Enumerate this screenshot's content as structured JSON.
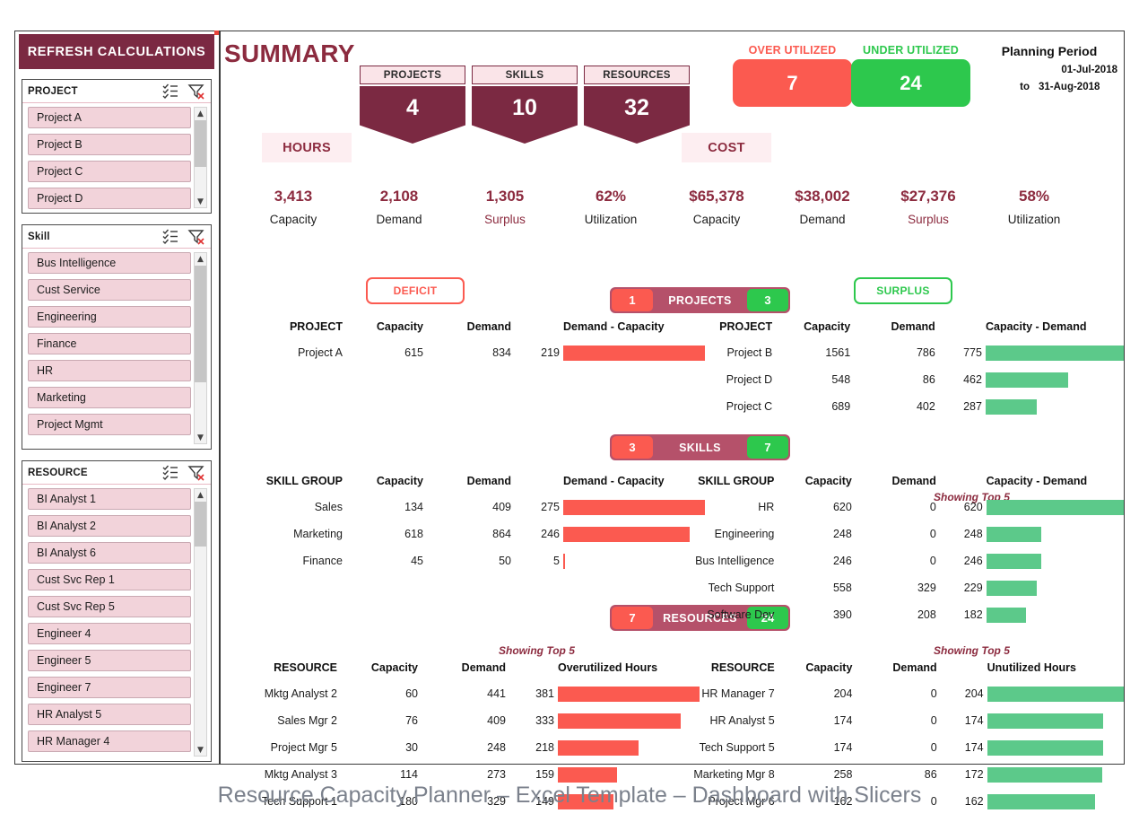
{
  "refresh_button": "REFRESH CALCULATIONS",
  "caption": "Resource Capacity Planner – Excel Template – Dashboard with Slicers",
  "colors": {
    "maroon": "#7b2942",
    "title_maroon": "#8c2b3f",
    "badge_band": "#b5516a",
    "red": "#fb5a50",
    "green": "#2dc84d",
    "bar_green": "#5cc98a",
    "slicer_item": "#f2d3da",
    "group_tag_bg": "#fdeef1",
    "caption_gray": "#7b818c"
  },
  "slicers": [
    {
      "id": "project",
      "title": "PROJECT",
      "multiselect_icon": "multi-select-icon",
      "clear_filter_icon": "clear-filter-icon",
      "items": [
        "Project A",
        "Project B",
        "Project C",
        "Project D"
      ]
    },
    {
      "id": "skill",
      "title": "Skill",
      "multiselect_icon": "multi-select-icon",
      "clear_filter_icon": "clear-filter-icon",
      "items": [
        "Bus Intelligence",
        "Cust Service",
        "Engineering",
        "Finance",
        "HR",
        "Marketing",
        "Project Mgmt"
      ]
    },
    {
      "id": "resource",
      "title": "RESOURCE",
      "multiselect_icon": "multi-select-icon",
      "clear_filter_icon": "clear-filter-icon",
      "items": [
        "BI Analyst 1",
        "BI Analyst 2",
        "BI Analyst 6",
        "Cust Svc Rep 1",
        "Cust Svc Rep 5",
        "Engineer 4",
        "Engineer 5",
        "Engineer 7",
        "HR Analyst 5",
        "HR Manager 4"
      ]
    }
  ],
  "header": {
    "title": "SUMMARY",
    "ribbons": [
      {
        "label": "PROJECTS",
        "value": "4"
      },
      {
        "label": "SKILLS",
        "value": "10"
      },
      {
        "label": "RESOURCES",
        "value": "32"
      }
    ],
    "utilization": [
      {
        "label": "OVER UTILIZED",
        "value": "7",
        "color": "#fb5a50",
        "label_color": "#fb5a50"
      },
      {
        "label": "UNDER UTILIZED",
        "value": "24",
        "color": "#2dc84d",
        "label_color": "#2dc84d"
      }
    ],
    "planning_period": {
      "title": "Planning Period",
      "from": "01-Jul-2018",
      "to_label": "to",
      "to": "31-Aug-2018"
    }
  },
  "groups": [
    {
      "tag": "HOURS",
      "metrics": [
        {
          "value": "3,413",
          "name": "Capacity",
          "accent": false
        },
        {
          "value": "2,108",
          "name": "Demand",
          "accent": false
        },
        {
          "value": "1,305",
          "name": "Surplus",
          "accent": true
        },
        {
          "value": "62%",
          "name": "Utilization",
          "accent": false
        }
      ]
    },
    {
      "tag": "COST",
      "metrics": [
        {
          "value": "$65,378",
          "name": "Capacity",
          "accent": false
        },
        {
          "value": "$38,002",
          "name": "Demand",
          "accent": false
        },
        {
          "value": "$27,376",
          "name": "Surplus",
          "accent": true
        },
        {
          "value": "58%",
          "name": "Utilization",
          "accent": false
        }
      ]
    }
  ],
  "badges": {
    "deficit": "DEFICIT",
    "surplus": "SURPLUS",
    "projects": {
      "name": "PROJECTS",
      "deficit_count": "1",
      "surplus_count": "3"
    },
    "skills": {
      "name": "SKILLS",
      "deficit_count": "3",
      "surplus_count": "7"
    },
    "resources": {
      "name": "RESOURCES",
      "deficit_count": "7",
      "surplus_count": "24"
    }
  },
  "showing_top": "Showing Top 5",
  "tables": {
    "projects_deficit": {
      "headers": [
        "PROJECT",
        "Capacity",
        "Demand",
        "Demand - Capacity"
      ],
      "rows": [
        {
          "name": "Project A",
          "capacity": "615",
          "demand": "834",
          "diff": "219",
          "bar_pct": 100
        }
      ]
    },
    "projects_surplus": {
      "headers": [
        "PROJECT",
        "Capacity",
        "Demand",
        "Capacity - Demand"
      ],
      "rows": [
        {
          "name": "Project B",
          "capacity": "1561",
          "demand": "786",
          "diff": "775",
          "bar_pct": 100
        },
        {
          "name": "Project D",
          "capacity": "548",
          "demand": "86",
          "diff": "462",
          "bar_pct": 60
        },
        {
          "name": "Project C",
          "capacity": "689",
          "demand": "402",
          "diff": "287",
          "bar_pct": 37
        }
      ]
    },
    "skills_deficit": {
      "headers": [
        "SKILL GROUP",
        "Capacity",
        "Demand",
        "Demand - Capacity"
      ],
      "rows": [
        {
          "name": "Sales",
          "capacity": "134",
          "demand": "409",
          "diff": "275",
          "bar_pct": 100
        },
        {
          "name": "Marketing",
          "capacity": "618",
          "demand": "864",
          "diff": "246",
          "bar_pct": 89
        },
        {
          "name": "Finance",
          "capacity": "45",
          "demand": "50",
          "diff": "5",
          "bar_pct": 1
        }
      ]
    },
    "skills_surplus": {
      "headers": [
        "SKILL GROUP",
        "Capacity",
        "Demand",
        "Capacity - Demand"
      ],
      "rows": [
        {
          "name": "HR",
          "capacity": "620",
          "demand": "0",
          "diff": "620",
          "bar_pct": 100
        },
        {
          "name": "Engineering",
          "capacity": "248",
          "demand": "0",
          "diff": "248",
          "bar_pct": 40
        },
        {
          "name": "Bus Intelligence",
          "capacity": "246",
          "demand": "0",
          "diff": "246",
          "bar_pct": 40
        },
        {
          "name": "Tech Support",
          "capacity": "558",
          "demand": "329",
          "diff": "229",
          "bar_pct": 37
        },
        {
          "name": "Software Dev",
          "capacity": "390",
          "demand": "208",
          "diff": "182",
          "bar_pct": 29
        }
      ]
    },
    "resources_over": {
      "headers": [
        "RESOURCE",
        "Capacity",
        "Demand",
        "Overutilized Hours"
      ],
      "rows": [
        {
          "name": "Mktg Analyst 2",
          "capacity": "60",
          "demand": "441",
          "diff": "381",
          "bar_pct": 100
        },
        {
          "name": "Sales Mgr 2",
          "capacity": "76",
          "demand": "409",
          "diff": "333",
          "bar_pct": 87
        },
        {
          "name": "Project Mgr 5",
          "capacity": "30",
          "demand": "248",
          "diff": "218",
          "bar_pct": 57
        },
        {
          "name": "Mktg Analyst 3",
          "capacity": "114",
          "demand": "273",
          "diff": "159",
          "bar_pct": 42
        },
        {
          "name": "Tech Support 1",
          "capacity": "180",
          "demand": "329",
          "diff": "149",
          "bar_pct": 39
        }
      ]
    },
    "resources_under": {
      "headers": [
        "RESOURCE",
        "Capacity",
        "Demand",
        "Unutilized Hours"
      ],
      "rows": [
        {
          "name": "HR Manager 7",
          "capacity": "204",
          "demand": "0",
          "diff": "204",
          "bar_pct": 100
        },
        {
          "name": "HR Analyst 5",
          "capacity": "174",
          "demand": "0",
          "diff": "174",
          "bar_pct": 85
        },
        {
          "name": "Tech Support 5",
          "capacity": "174",
          "demand": "0",
          "diff": "174",
          "bar_pct": 85
        },
        {
          "name": "Marketing Mgr 8",
          "capacity": "258",
          "demand": "86",
          "diff": "172",
          "bar_pct": 84
        },
        {
          "name": "Project Mgr 6",
          "capacity": "162",
          "demand": "0",
          "diff": "162",
          "bar_pct": 79
        }
      ]
    }
  }
}
